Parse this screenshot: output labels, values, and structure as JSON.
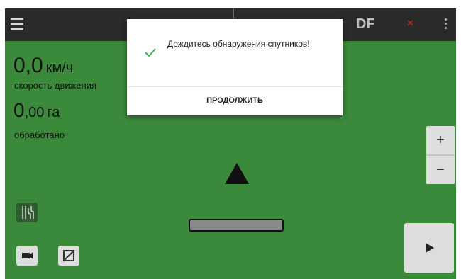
{
  "topbar": {
    "menu_icon": "hamburger-menu-icon",
    "df_label": "DF",
    "gps_status_icon": "no-gps-x-icon",
    "gps_status_color": "#e02020",
    "overflow_icon": "kebab-menu-icon"
  },
  "stats": {
    "speed_value": "0,0",
    "speed_unit": "км/ч",
    "speed_label": "скорость движения",
    "area_value_int": "0",
    "area_value_dec": ",00",
    "area_unit": "га",
    "area_label": "обработано"
  },
  "zoom": {
    "in_label": "+",
    "out_label": "−"
  },
  "dialog": {
    "message": "Дождитесь обнаружения спутников!",
    "icon": "checkmark-icon",
    "icon_color": "#4caf50",
    "button_label": "ПРОДОЛЖИТЬ"
  },
  "tools": {
    "tracks_icon": "tracks-icon",
    "camera_icon": "camera-icon",
    "map_layer_icon": "map-off-icon",
    "play_icon": "play-icon"
  },
  "colors": {
    "field": "#3b8a3b",
    "topbar": "#2a2a2a",
    "tracks_button": "#2e5a30"
  }
}
